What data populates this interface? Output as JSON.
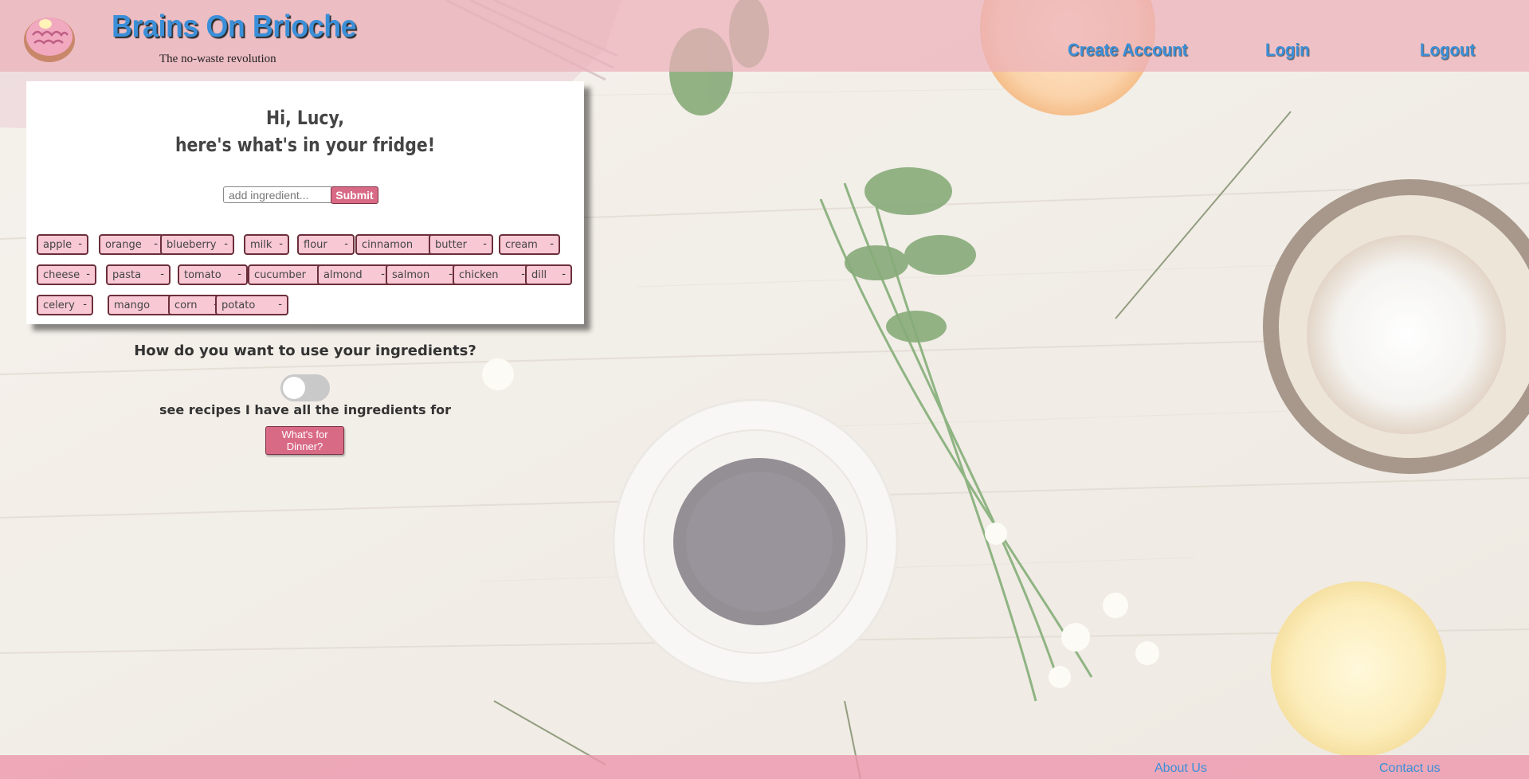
{
  "brand": {
    "title": "Brains On Brioche",
    "tagline": "The no-waste revolution",
    "logo_icon": "brain-donut-icon"
  },
  "nav": {
    "create_account": "Create Account",
    "login": "Login",
    "logout": "Logout"
  },
  "fridge": {
    "greeting_line1": "Hi, Lucy,",
    "greeting_line2": "here's what's in your fridge!",
    "input_placeholder": "add ingredient...",
    "submit_label": "Submit",
    "remove_symbol": "-",
    "ingredients": [
      "apple",
      "orange",
      "blueberry",
      "milk",
      "flour",
      "cinnamon",
      "butter",
      "cream",
      "cheese",
      "pasta",
      "tomato",
      "cucumber",
      "almond",
      "salmon",
      "chicken",
      "dill",
      "celery",
      "mango",
      "corn",
      "potato"
    ]
  },
  "options": {
    "question": "How do you want to use your ingredients?",
    "toggle_on": false,
    "toggle_label": "see recipes I have all the ingredients for",
    "dinner_button": "What's for Dinner?"
  },
  "footer": {
    "about": "About Us",
    "contact": "Contact us"
  },
  "colors": {
    "header_pink": "#ecb0ba",
    "button_pink": "#d96a86",
    "chip_pink": "#f8c8d4",
    "link_blue": "#3b8fd8"
  }
}
